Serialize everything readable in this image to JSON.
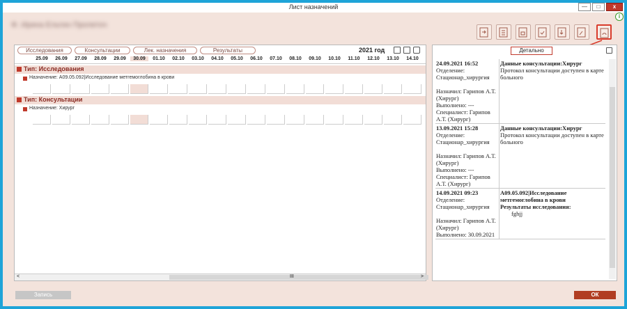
{
  "window": {
    "title": "Лист назначений",
    "min": "—",
    "max": "□",
    "close": "x"
  },
  "info_icon": "i",
  "patient_name": "Ф. Ирина Ельтин Пролеточ",
  "tabs": [
    "Исследования",
    "Консультации",
    "Лек. назначения",
    "Результаты"
  ],
  "year": "2021 год",
  "dates": [
    "25.09",
    "26.09",
    "27.09",
    "28.09",
    "29.09",
    "30.09",
    "01.10",
    "02.10",
    "03.10",
    "04.10",
    "05.10",
    "06.10",
    "07.10",
    "08.10",
    "09.10",
    "10.10",
    "11.10",
    "12.10",
    "13.10",
    "14.10"
  ],
  "groups": [
    {
      "title": "Тип: Исследования",
      "assignment": "Назначение: A09.05.092|Исследование метгемоглобина в крови"
    },
    {
      "title": "Тип: Консультации",
      "assignment": "Назначение: Хирург"
    }
  ],
  "scroll": {
    "left": "<",
    "center": "III",
    "right": ">"
  },
  "details_label": "Детально",
  "log": [
    {
      "ts": "24.09.2021 16:52",
      "left": "Отделение: Стационар_хирургия\n\nНазначил: Гарипов А.Т. (Хирург)\nВыполнено: ---\nСпециалист: Гарипов А.Т. (Хирург)",
      "title": "Данные консультации:Хирург",
      "body": "Протокол консультации доступен в карте больного"
    },
    {
      "ts": "13.09.2021 15:28",
      "left": "Отделение: Стационар_хирургия\n\nНазначил: Гарипов А.Т. (Хирург)\nВыполнено: ---\nСпециалист: Гарипов А.Т. (Хирург)",
      "title": "Данные консультации:Хирург",
      "body": "Протокол консультации доступен в карте больного"
    },
    {
      "ts": "14.09.2021 09:23",
      "left": "Отделение: Стационар_хирургия\n\nНазначил: Гарипов А.Т. (Хирург)\nВыполнено: 30.09.2021",
      "title": "A09.05.092|Исследование метгемоглобина в крови",
      "subtitle": "Результаты исследования:",
      "body": "fghjj"
    }
  ],
  "buttons": {
    "record": "Запись",
    "ok": "ОК"
  }
}
